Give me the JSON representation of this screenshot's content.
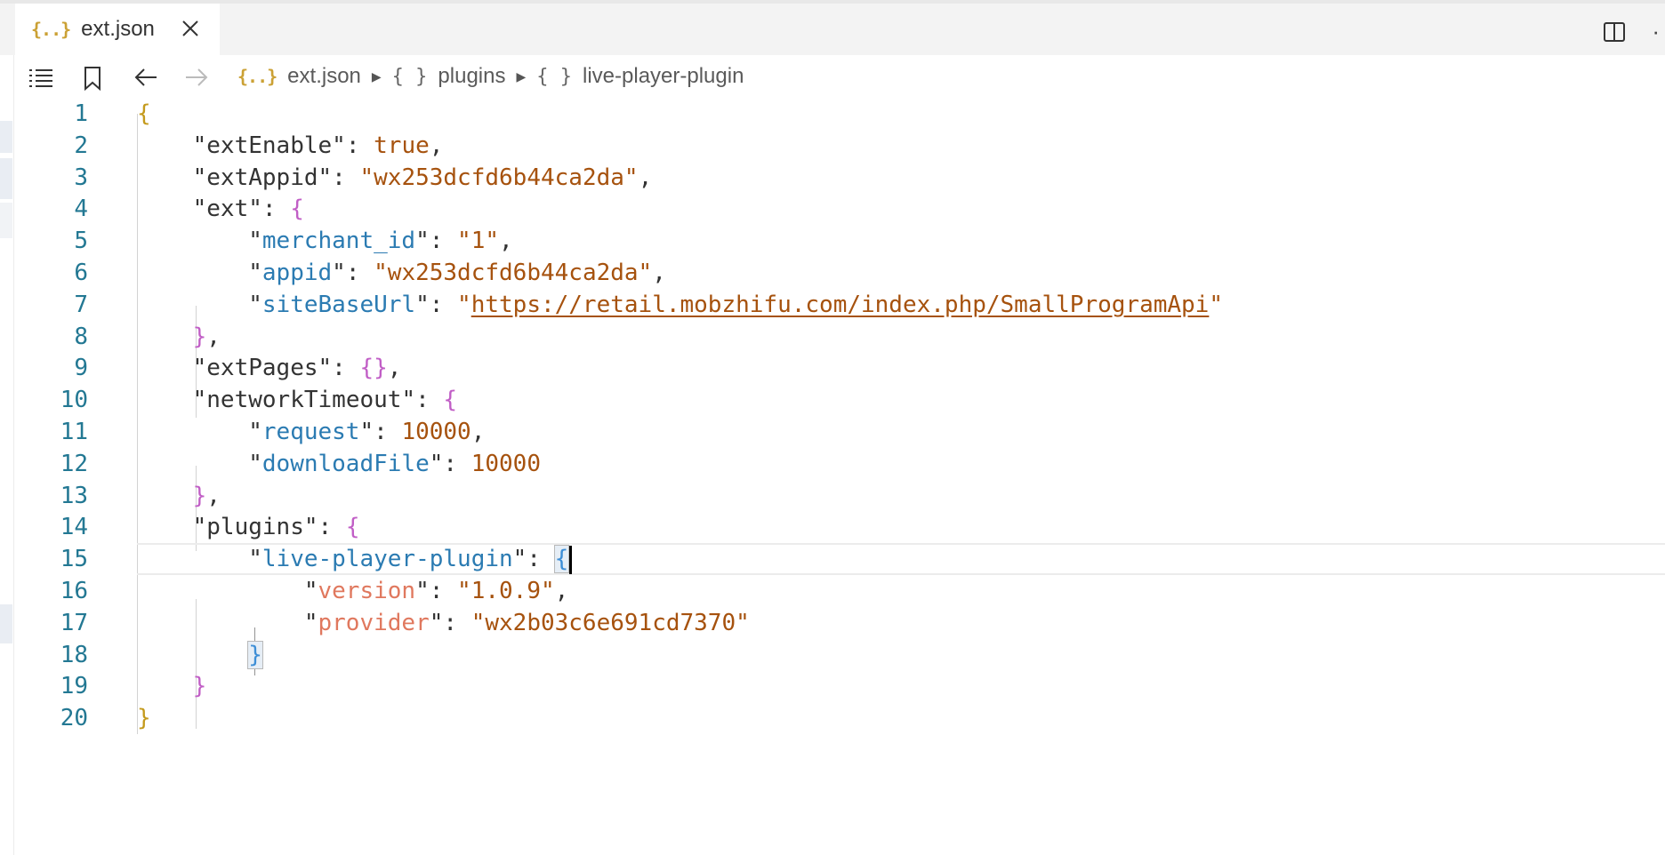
{
  "tab": {
    "icon": "json-file-icon",
    "icon_glyph": "{..}",
    "label": "ext.json"
  },
  "breadcrumb": {
    "file": "ext.json",
    "items": [
      "plugins",
      "live-player-plugin"
    ],
    "object_glyph": "{ }"
  },
  "editor": {
    "lines": [
      {
        "num": "1",
        "tokens": [
          [
            "br1",
            "{"
          ]
        ]
      },
      {
        "num": "2",
        "tokens": [
          [
            "q",
            "    \""
          ],
          [
            "k0",
            "extEnable"
          ],
          [
            "q",
            "\""
          ],
          [
            "p",
            ": "
          ],
          [
            "b",
            "true"
          ],
          [
            "p",
            ","
          ]
        ]
      },
      {
        "num": "3",
        "tokens": [
          [
            "q",
            "    \""
          ],
          [
            "k0",
            "extAppid"
          ],
          [
            "q",
            "\""
          ],
          [
            "p",
            ": "
          ],
          [
            "s",
            "\"wx253dcfd6b44ca2da\""
          ],
          [
            "p",
            ","
          ]
        ]
      },
      {
        "num": "4",
        "tokens": [
          [
            "q",
            "    \""
          ],
          [
            "k0",
            "ext"
          ],
          [
            "q",
            "\""
          ],
          [
            "p",
            ": "
          ],
          [
            "br2",
            "{"
          ]
        ]
      },
      {
        "num": "5",
        "tokens": [
          [
            "q",
            "        \""
          ],
          [
            "k1",
            "merchant_id"
          ],
          [
            "q",
            "\""
          ],
          [
            "p",
            ": "
          ],
          [
            "s",
            "\"1\""
          ],
          [
            "p",
            ","
          ]
        ]
      },
      {
        "num": "6",
        "tokens": [
          [
            "q",
            "        \""
          ],
          [
            "k1",
            "appid"
          ],
          [
            "q",
            "\""
          ],
          [
            "p",
            ": "
          ],
          [
            "s",
            "\"wx253dcfd6b44ca2da\""
          ],
          [
            "p",
            ","
          ]
        ]
      },
      {
        "num": "7",
        "tokens": [
          [
            "q",
            "        \""
          ],
          [
            "k1",
            "siteBaseUrl"
          ],
          [
            "q",
            "\""
          ],
          [
            "p",
            ": "
          ],
          [
            "s",
            "\""
          ],
          [
            "url",
            "https://retail.mobzhifu.com/index.php/SmallProgramApi"
          ],
          [
            "s",
            "\""
          ]
        ]
      },
      {
        "num": "8",
        "tokens": [
          [
            "br2",
            "    }"
          ],
          [
            "p",
            ","
          ]
        ]
      },
      {
        "num": "9",
        "tokens": [
          [
            "q",
            "    \""
          ],
          [
            "k0",
            "extPages"
          ],
          [
            "q",
            "\""
          ],
          [
            "p",
            ": "
          ],
          [
            "br2",
            "{}"
          ],
          [
            "p",
            ","
          ]
        ]
      },
      {
        "num": "10",
        "tokens": [
          [
            "q",
            "    \""
          ],
          [
            "k0",
            "networkTimeout"
          ],
          [
            "q",
            "\""
          ],
          [
            "p",
            ": "
          ],
          [
            "br2",
            "{"
          ]
        ]
      },
      {
        "num": "11",
        "tokens": [
          [
            "q",
            "        \""
          ],
          [
            "k1",
            "request"
          ],
          [
            "q",
            "\""
          ],
          [
            "p",
            ": "
          ],
          [
            "n",
            "10000"
          ],
          [
            "p",
            ","
          ]
        ]
      },
      {
        "num": "12",
        "tokens": [
          [
            "q",
            "        \""
          ],
          [
            "k1",
            "downloadFile"
          ],
          [
            "q",
            "\""
          ],
          [
            "p",
            ": "
          ],
          [
            "n",
            "10000"
          ]
        ]
      },
      {
        "num": "13",
        "tokens": [
          [
            "br2",
            "    }"
          ],
          [
            "p",
            ","
          ]
        ]
      },
      {
        "num": "14",
        "tokens": [
          [
            "q",
            "    \""
          ],
          [
            "k0",
            "plugins"
          ],
          [
            "q",
            "\""
          ],
          [
            "p",
            ": "
          ],
          [
            "br2",
            "{"
          ]
        ]
      },
      {
        "num": "15",
        "tokens": [
          [
            "q",
            "        \""
          ],
          [
            "k1",
            "live-player-plugin"
          ],
          [
            "q",
            "\""
          ],
          [
            "p",
            ": "
          ],
          [
            "br3m",
            "{"
          ],
          [
            "cursor",
            ""
          ]
        ]
      },
      {
        "num": "16",
        "tokens": [
          [
            "q",
            "            \""
          ],
          [
            "k2",
            "version"
          ],
          [
            "q",
            "\""
          ],
          [
            "p",
            ": "
          ],
          [
            "s",
            "\"1.0.9\""
          ],
          [
            "p",
            ","
          ]
        ]
      },
      {
        "num": "17",
        "tokens": [
          [
            "q",
            "            \""
          ],
          [
            "k2",
            "provider"
          ],
          [
            "q",
            "\""
          ],
          [
            "p",
            ": "
          ],
          [
            "s",
            "\"wx2b03c6e691cd7370\""
          ]
        ]
      },
      {
        "num": "18",
        "tokens": [
          [
            "br3m",
            "        }"
          ]
        ]
      },
      {
        "num": "19",
        "tokens": [
          [
            "br2",
            "    }"
          ]
        ]
      },
      {
        "num": "20",
        "tokens": [
          [
            "br1",
            "}"
          ]
        ]
      }
    ]
  }
}
